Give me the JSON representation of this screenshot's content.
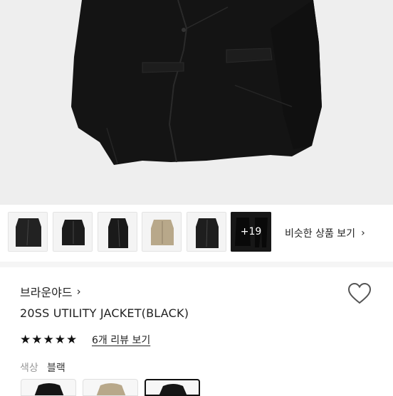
{
  "thumbnails": [
    {
      "name": "thumbnail-1",
      "color": "#222222"
    },
    {
      "name": "thumbnail-2",
      "color": "#1c1c1c"
    },
    {
      "name": "thumbnail-3",
      "color": "#1a1a1a"
    },
    {
      "name": "thumbnail-4",
      "color": "#b8a88a"
    },
    {
      "name": "thumbnail-5",
      "color": "#1e1e1e"
    }
  ],
  "more_photos": "+19",
  "similar_products": "비슷한 상품 보기",
  "brand": "브라운야드",
  "product_title": "20SS UTILITY JACKET(BLACK)",
  "rating": {
    "stars": 5,
    "review_link": "6개 리뷰 보기"
  },
  "option": {
    "label": "색상",
    "value": "블랙"
  },
  "colors": {
    "jacket": "#151515",
    "hero_bg": "#efefef",
    "beige": "#b8a88a"
  }
}
